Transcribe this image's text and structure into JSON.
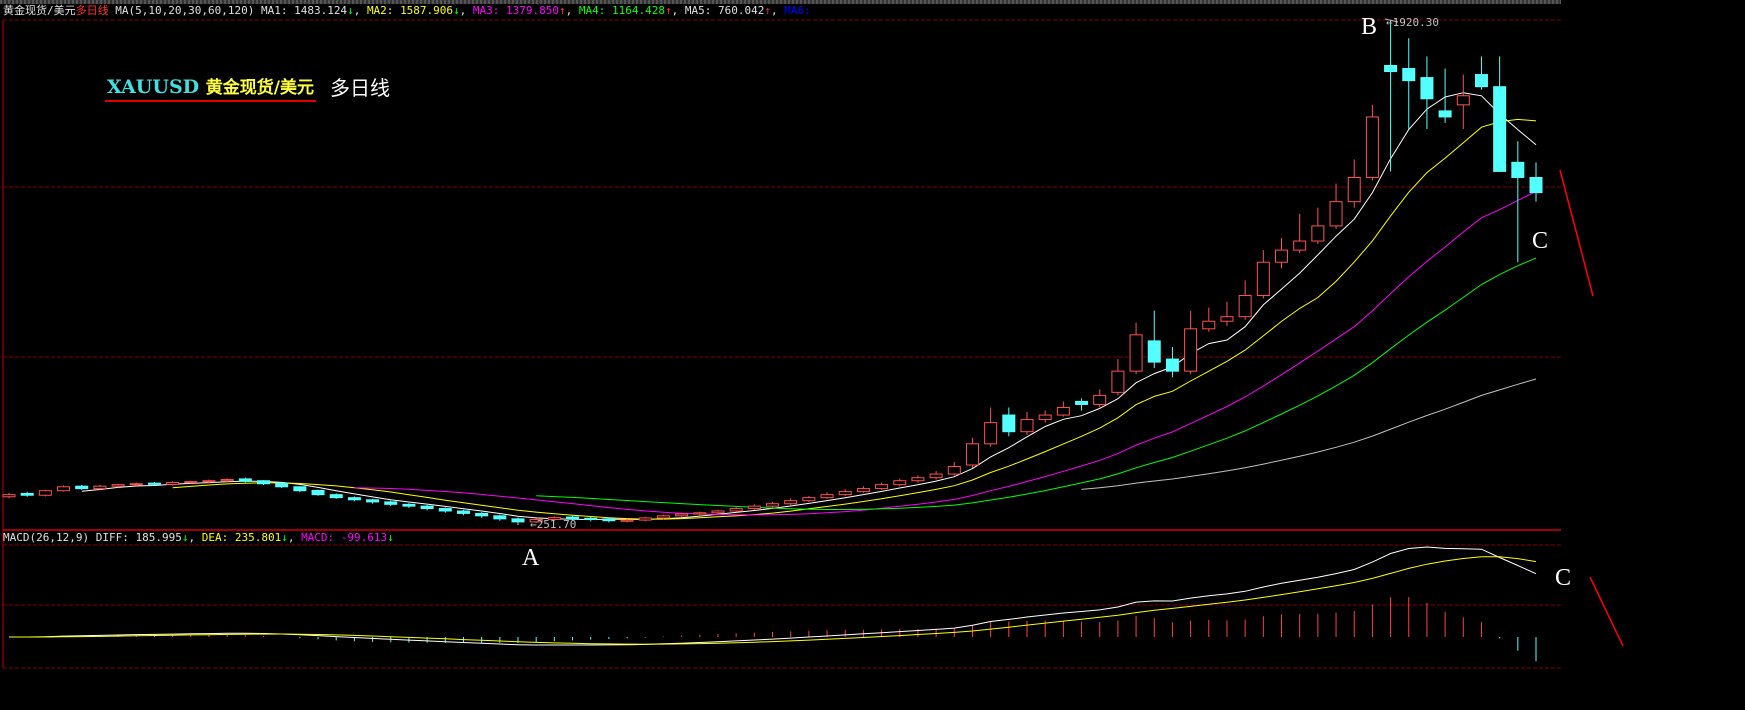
{
  "header": {
    "instrument": "黄金现货/美元",
    "period": "多日线",
    "ma_params": "MA(5,10,20,30,60,120)",
    "ma1": {
      "label": "MA1:",
      "value": "1483.124",
      "arrow": "↓"
    },
    "ma2": {
      "label": "MA2:",
      "value": "1587.906",
      "arrow": "↓"
    },
    "ma3": {
      "label": "MA3:",
      "value": "1379.850",
      "arrow": "↑"
    },
    "ma4": {
      "label": "MA4:",
      "value": "1164.428",
      "arrow": "↑"
    },
    "ma5": {
      "label": "MA5:",
      "value": "760.042",
      "arrow": "↑"
    },
    "ma6": {
      "label": "MA6:"
    }
  },
  "macd_header": {
    "params": "MACD(26,12,9)",
    "diff": {
      "label": "DIFF:",
      "value": "185.995",
      "arrow": "↓"
    },
    "dea": {
      "label": "DEA:",
      "value": "235.801",
      "arrow": "↓"
    },
    "macd": {
      "label": "MACD:",
      "value": "-99.613",
      "arrow": "↓"
    }
  },
  "annotation": {
    "symbol": "XAUUSD",
    "name": "黄金现货/美元",
    "period": "多日线",
    "point_a": "A",
    "point_b": "B",
    "point_c": "C",
    "point_c_macd": "C",
    "high_label": "←1920.30",
    "low_label": "←251.70"
  },
  "colors": {
    "up": "#ff5050",
    "down": "#54ffff",
    "ma1": "#ffffff",
    "ma2": "#ffff00",
    "ma3": "#ff00ff",
    "ma4": "#00ff00",
    "ma5": "#c0c0c0",
    "grid": "#800000"
  },
  "chart_data": {
    "type": "candlestick",
    "price_range": [
      251.7,
      1920.3
    ],
    "ma_periods": [
      5,
      10,
      20,
      30,
      60
    ],
    "open": [
      345,
      356,
      350,
      365,
      380,
      372,
      380,
      385,
      390,
      386,
      392,
      395,
      398,
      404,
      398,
      390,
      378,
      366,
      352,
      342,
      335,
      328,
      320,
      314,
      306,
      298,
      290,
      282,
      272,
      262,
      270,
      278,
      274,
      272,
      264,
      268,
      275,
      282,
      288,
      292,
      298,
      306,
      314,
      322,
      332,
      342,
      352,
      362,
      372,
      385,
      398,
      408,
      420,
      450,
      520,
      615,
      560,
      600,
      615,
      660,
      650,
      690,
      760,
      860,
      800,
      760,
      900,
      925,
      940,
      1010,
      1120,
      1160,
      1190,
      1240,
      1320,
      1400,
      1770,
      1760,
      1730,
      1620,
      1640,
      1740,
      1700,
      1450,
      1400
    ],
    "high": [
      358,
      362,
      368,
      382,
      384,
      384,
      388,
      392,
      394,
      396,
      398,
      402,
      406,
      408,
      400,
      392,
      380,
      368,
      356,
      346,
      338,
      332,
      324,
      318,
      310,
      302,
      294,
      286,
      276,
      274,
      280,
      282,
      278,
      276,
      272,
      279,
      286,
      292,
      296,
      302,
      312,
      320,
      328,
      340,
      348,
      360,
      370,
      380,
      392,
      405,
      416,
      430,
      460,
      540,
      640,
      640,
      625,
      630,
      660,
      670,
      700,
      800,
      920,
      960,
      840,
      960,
      970,
      990,
      1060,
      1160,
      1200,
      1280,
      1300,
      1380,
      1460,
      1640,
      1920.3,
      1860,
      1800,
      1760,
      1740,
      1800,
      1800,
      1520,
      1450
    ],
    "low": [
      340,
      345,
      346,
      362,
      368,
      368,
      376,
      380,
      382,
      382,
      388,
      390,
      394,
      392,
      384,
      374,
      360,
      348,
      338,
      330,
      322,
      314,
      308,
      300,
      292,
      284,
      276,
      266,
      251.7,
      258,
      264,
      268,
      264,
      260,
      260,
      264,
      270,
      278,
      284,
      288,
      294,
      302,
      310,
      318,
      328,
      338,
      348,
      358,
      368,
      380,
      392,
      402,
      415,
      440,
      510,
      545,
      550,
      590,
      610,
      630,
      640,
      680,
      750,
      770,
      740,
      750,
      890,
      910,
      930,
      1000,
      1100,
      1150,
      1180,
      1230,
      1300,
      1390,
      1420,
      1560,
      1560,
      1580,
      1560,
      1690,
      1580,
      1120,
      1320
    ],
    "close": [
      352,
      350,
      365,
      378,
      372,
      380,
      385,
      388,
      386,
      392,
      395,
      398,
      402,
      396,
      388,
      378,
      365,
      352,
      342,
      335,
      328,
      320,
      314,
      306,
      298,
      290,
      282,
      272,
      262,
      270,
      276,
      272,
      270,
      266,
      268,
      275,
      282,
      288,
      292,
      298,
      306,
      314,
      322,
      332,
      342,
      352,
      362,
      372,
      385,
      398,
      408,
      420,
      445,
      520,
      590,
      560,
      600,
      615,
      640,
      650,
      680,
      760,
      880,
      790,
      760,
      900,
      925,
      940,
      1010,
      1120,
      1160,
      1190,
      1240,
      1320,
      1400,
      1600,
      1750,
      1720,
      1660,
      1600,
      1670,
      1700,
      1420,
      1400,
      1350
    ]
  }
}
